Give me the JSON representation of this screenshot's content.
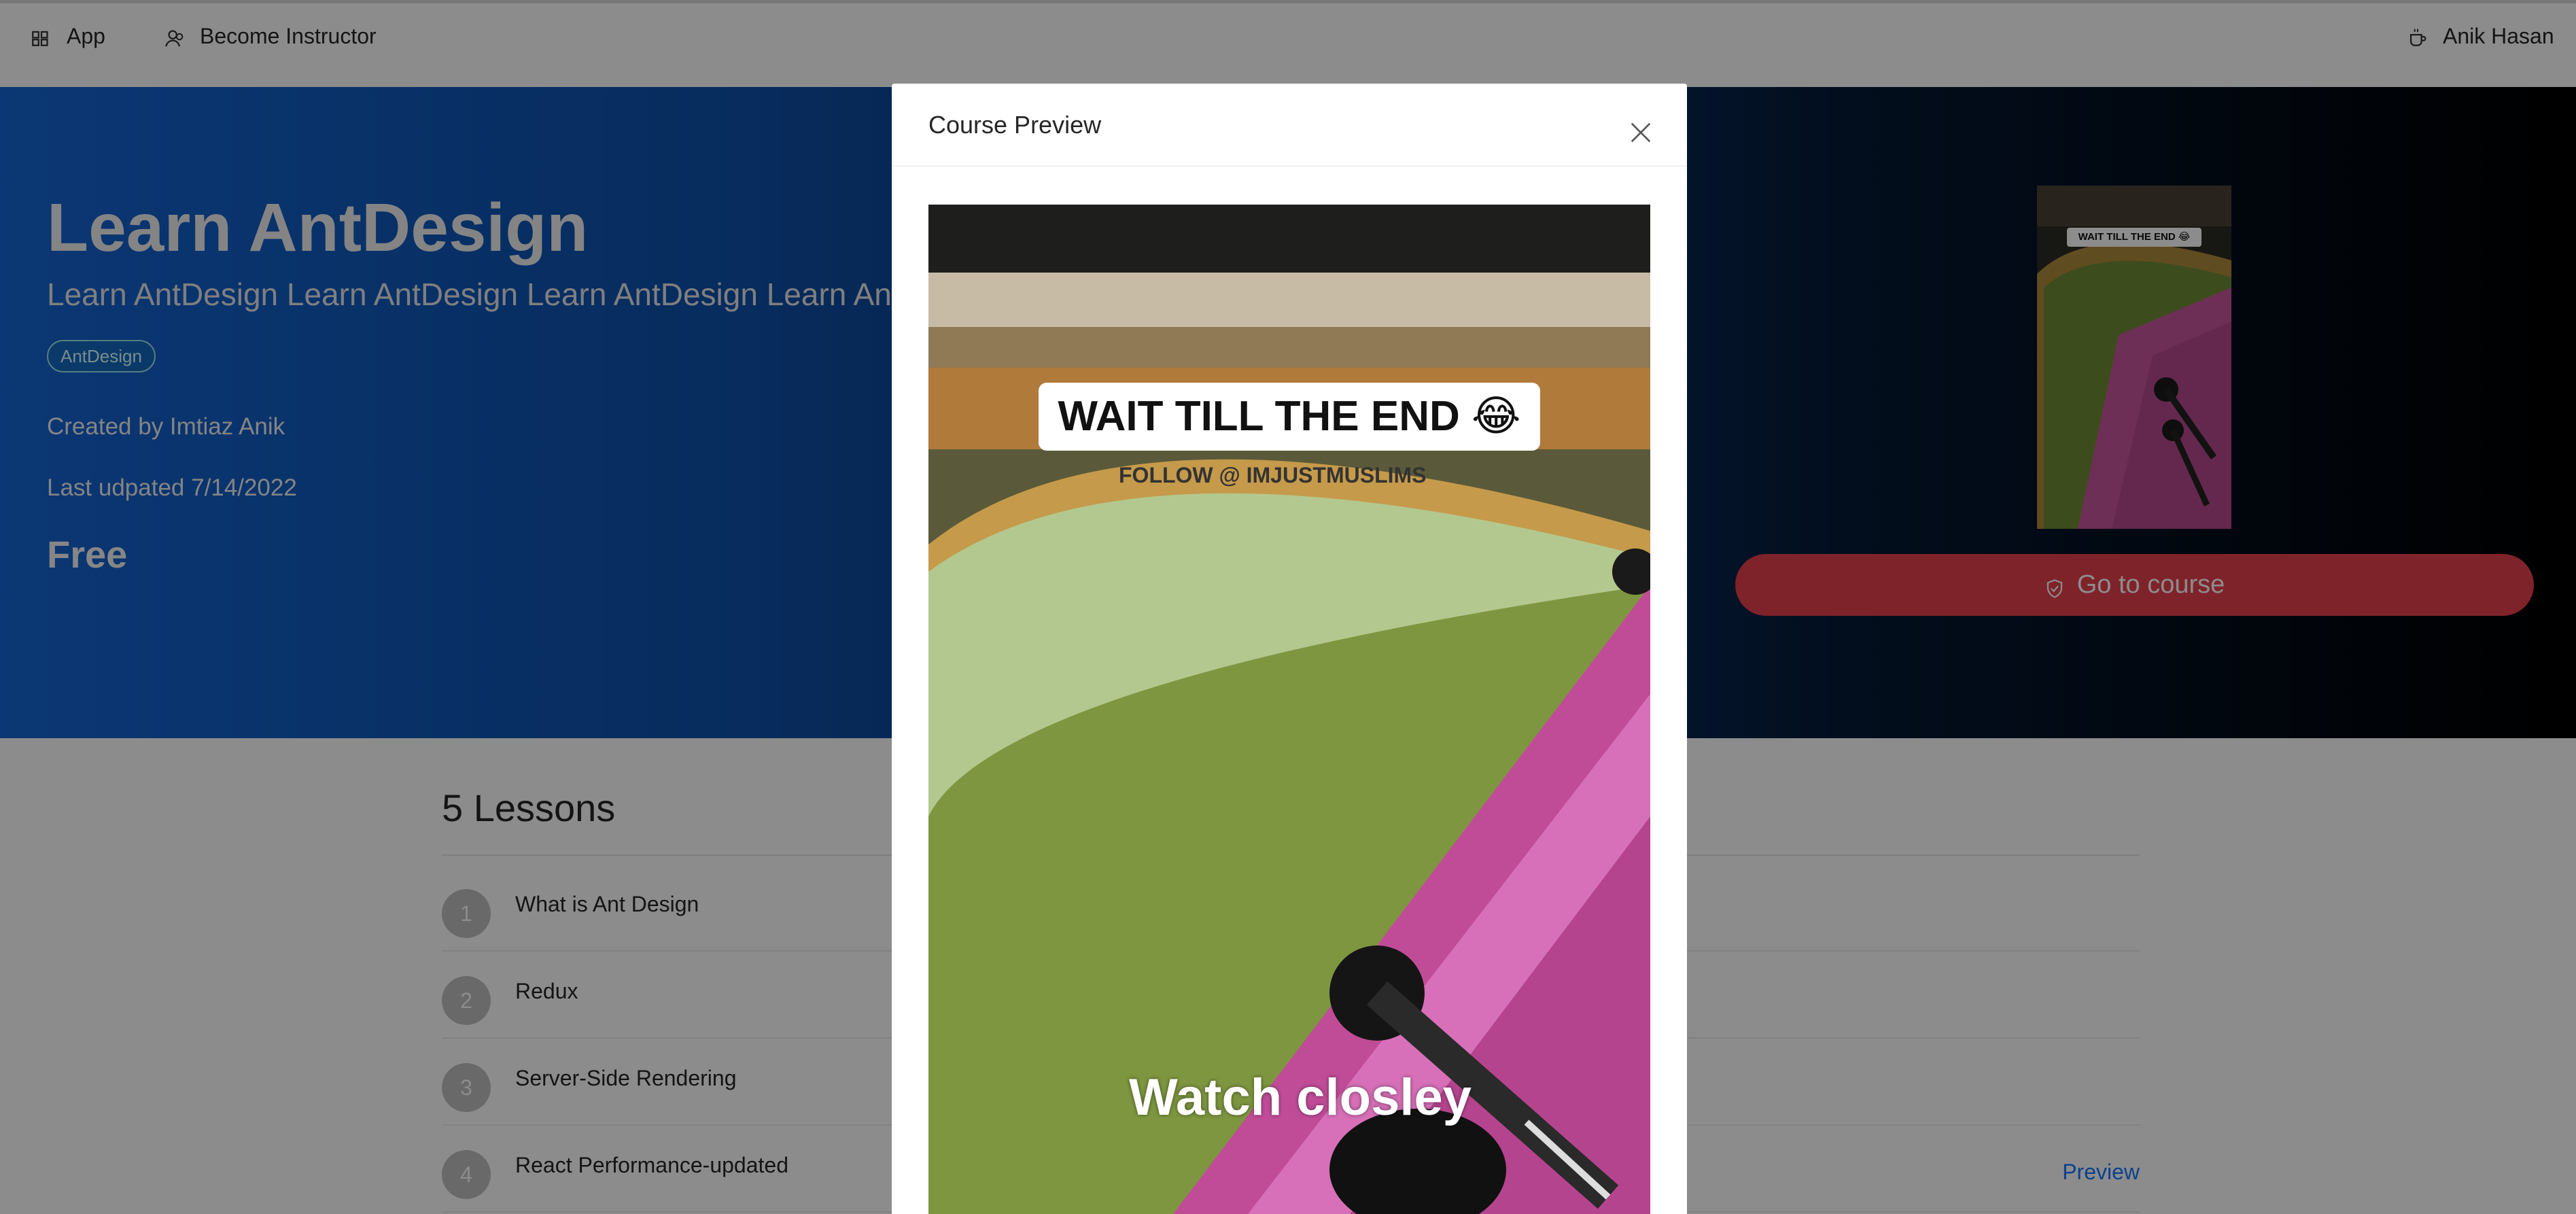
{
  "nav": {
    "app_label": "App",
    "become_instructor_label": "Become Instructor",
    "user_name": "Anik Hasan"
  },
  "hero": {
    "title": "Learn AntDesign",
    "subtitle": "Learn AntDesign Learn AntDesign Learn AntDesign Learn AntDesign",
    "tag": "AntDesign",
    "created_by": "Created by Imtiaz Anik",
    "last_updated": "Last udpated 7/14/2022",
    "price": "Free",
    "go_to_course_label": "Go to course",
    "thumb_caption": "WAIT TILL THE END 😂"
  },
  "lessons": {
    "title": "5 Lessons",
    "preview_label": "Preview",
    "items": [
      {
        "num": "1",
        "label": "What is Ant Design"
      },
      {
        "num": "2",
        "label": "Redux"
      },
      {
        "num": "3",
        "label": "Server-Side Rendering"
      },
      {
        "num": "4",
        "label": "React Performance-updated"
      }
    ]
  },
  "modal": {
    "title": "Course Preview",
    "video_caption_top": "WAIT TILL THE END 😂",
    "video_caption_follow": "FOLLOW @ IMJUSTMUSLIMS",
    "video_caption_bottom": "Watch closley"
  },
  "colors": {
    "accent_red": "#e8414e",
    "link_blue": "#1677ff",
    "hero_start": "#1565d3",
    "hero_end": "#000000"
  }
}
